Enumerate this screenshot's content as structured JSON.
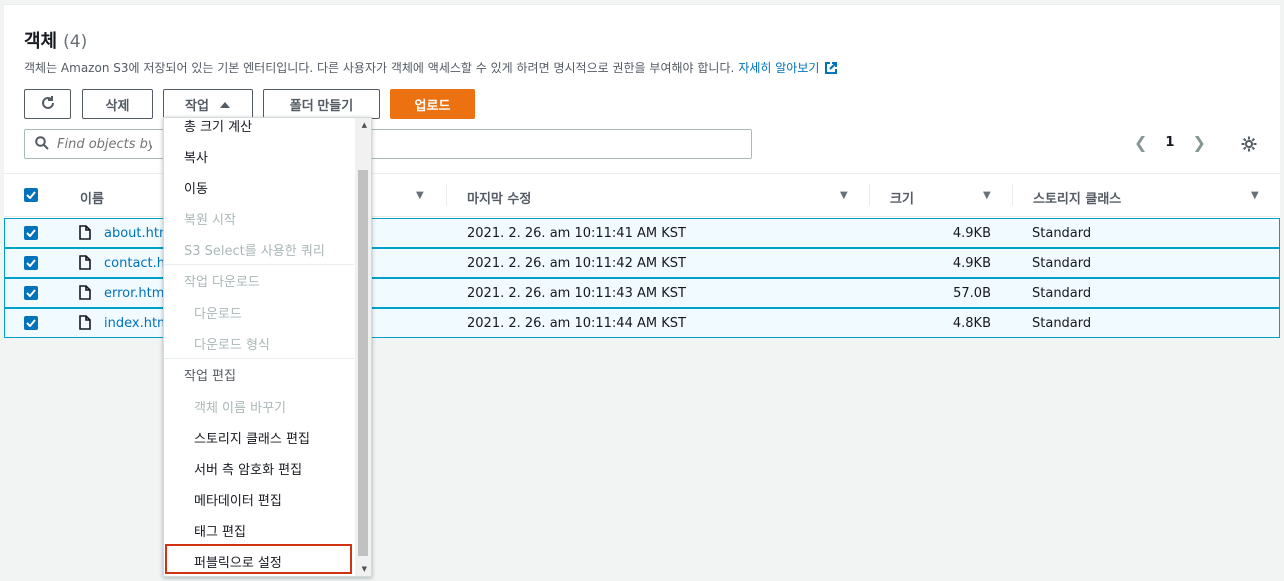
{
  "header": {
    "title": "객체",
    "count": "(4)",
    "description": "객체는 Amazon S3에 저장되어 있는 기본 엔터티입니다. 다른 사용자가 객체에 액세스할 수 있게 하려면 명시적으로 권한을 부여해야 합니다.",
    "learn_more": "자세히 알아보기"
  },
  "toolbar": {
    "refresh_icon": "refresh-icon",
    "delete_label": "삭제",
    "actions_label": "작업",
    "create_folder_label": "폴더 만들기",
    "upload_label": "업로드"
  },
  "search": {
    "placeholder": "Find objects by p"
  },
  "pagination": {
    "current_page": "1"
  },
  "table": {
    "columns": [
      "이름",
      "마지막 수정",
      "크기",
      "스토리지 클래스"
    ],
    "rows": [
      {
        "name": "about.htm",
        "modified": "2021. 2. 26. am 10:11:41 AM KST",
        "size": "4.9KB",
        "storage": "Standard"
      },
      {
        "name": "contact.h",
        "modified": "2021. 2. 26. am 10:11:42 AM KST",
        "size": "4.9KB",
        "storage": "Standard"
      },
      {
        "name": "error.htm",
        "modified": "2021. 2. 26. am 10:11:43 AM KST",
        "size": "57.0B",
        "storage": "Standard"
      },
      {
        "name": "index.htm",
        "modified": "2021. 2. 26. am 10:11:44 AM KST",
        "size": "4.8KB",
        "storage": "Standard"
      }
    ]
  },
  "actions_menu": {
    "total_size": "총 크기 계산",
    "copy": "복사",
    "move": "이동",
    "restore": "복원 시작",
    "s3_select": "S3 Select를 사용한 쿼리",
    "download_group": "작업 다운로드",
    "download": "다운로드",
    "download_as": "다운로드 형식",
    "edit_group": "작업 편집",
    "rename": "객체 이름 바꾸기",
    "edit_storage_class": "스토리지 클래스 편집",
    "edit_encryption": "서버 측 암호화 편집",
    "edit_metadata": "메타데이터 편집",
    "edit_tags": "태그 편집",
    "make_public": "퍼블릭으로 설정"
  },
  "colors": {
    "accent": "#0073bb",
    "upload": "#ec7211",
    "highlight": "#d13212"
  }
}
